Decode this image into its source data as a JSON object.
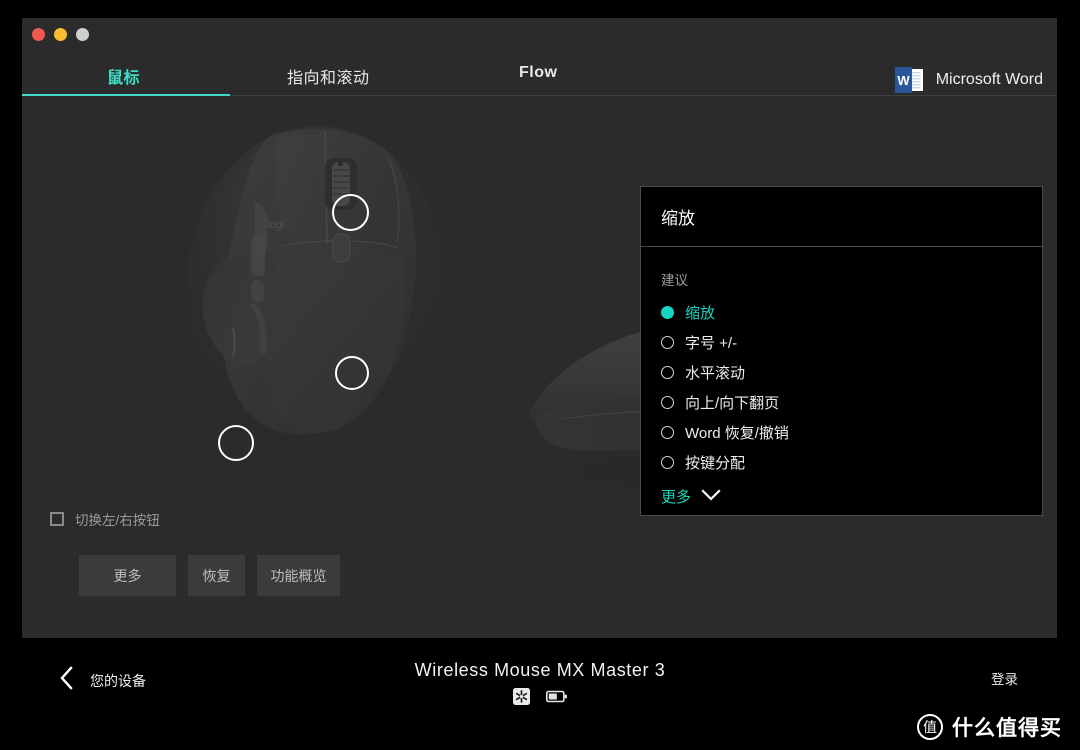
{
  "window": {
    "traffic_lights": [
      {
        "name": "close",
        "color": "#f35751"
      },
      {
        "name": "minimize",
        "color": "#f9bd2e"
      },
      {
        "name": "zoom",
        "color": "#cfcfcf"
      }
    ]
  },
  "header": {
    "tabs": [
      {
        "label": "鼠标",
        "active": true
      },
      {
        "label": "指向和滚动",
        "active": false
      },
      {
        "label": "Flow",
        "active": false
      }
    ],
    "active_color": "#3ddbc8",
    "app": {
      "icon": "microsoft-word-icon",
      "name": "Microsoft Word",
      "icon_color": "#2b579a"
    }
  },
  "stage": {
    "device_image_alt": "Logitech MX Master 3 mouse top view",
    "device_image_side_alt": "Logitech MX Master 3 mouse side view",
    "brand_mark": "logi",
    "hotspots": [
      {
        "name": "scroll-wheel-hotspot"
      },
      {
        "name": "mode-shift-button-hotspot"
      },
      {
        "name": "thumb-button-hotspot"
      }
    ],
    "checkbox": {
      "label": "切换左/右按钮",
      "checked": false
    },
    "buttons": [
      {
        "label": "更多",
        "name": "more-button"
      },
      {
        "label": "恢复",
        "name": "restore-button"
      },
      {
        "label": "功能概览",
        "name": "feature-overview-button"
      }
    ]
  },
  "panel": {
    "title": "缩放",
    "section_label": "建议",
    "accent_color": "#19d6c0",
    "options": [
      {
        "label": "缩放",
        "selected": true
      },
      {
        "label": "字号 +/-",
        "selected": false
      },
      {
        "label": "水平滚动",
        "selected": false
      },
      {
        "label": "向上/向下翻页",
        "selected": false
      },
      {
        "label": "Word 恢复/撤销",
        "selected": false
      },
      {
        "label": "按键分配",
        "selected": false
      }
    ],
    "more_label": "更多",
    "more_icon": "chevron-down-icon"
  },
  "footer": {
    "back_icon": "chevron-left-icon",
    "back_label": "您的设备",
    "device_name": "Wireless Mouse MX Master 3",
    "device_status_icons": [
      "unifying-receiver-icon",
      "battery-icon"
    ],
    "signin_label": "登录",
    "watermark": {
      "mark": "值",
      "text": "什么值得买"
    }
  }
}
